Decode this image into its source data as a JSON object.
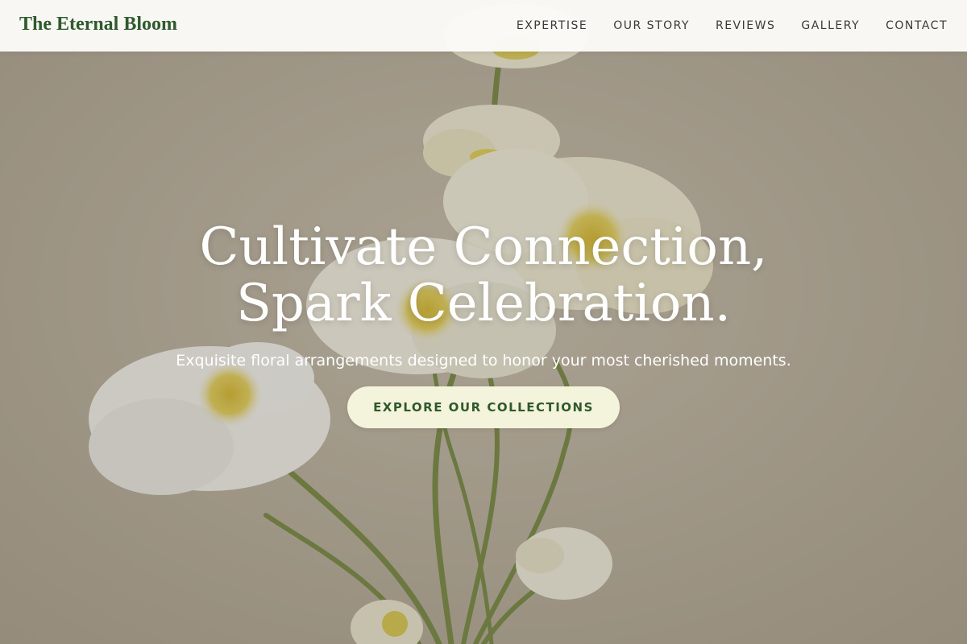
{
  "brand": {
    "name": "The Eternal Bloom",
    "color": "#2f5a2c"
  },
  "nav": {
    "items": [
      {
        "label": "EXPERTISE"
      },
      {
        "label": "OUR STORY"
      },
      {
        "label": "REVIEWS"
      },
      {
        "label": "GALLERY"
      },
      {
        "label": "CONTACT"
      }
    ]
  },
  "hero": {
    "title_line1": "Cultivate Connection,",
    "title_line2": "Spark Celebration.",
    "subtitle": "Exquisite floral arrangements designed to honor your most cherished moments.",
    "cta_label": "EXPLORE OUR COLLECTIONS",
    "background_image": "white-poppies-photo",
    "colors": {
      "cta_background": "#f4f3dc",
      "cta_text": "#2f5a2c",
      "text": "#ffffff"
    }
  }
}
